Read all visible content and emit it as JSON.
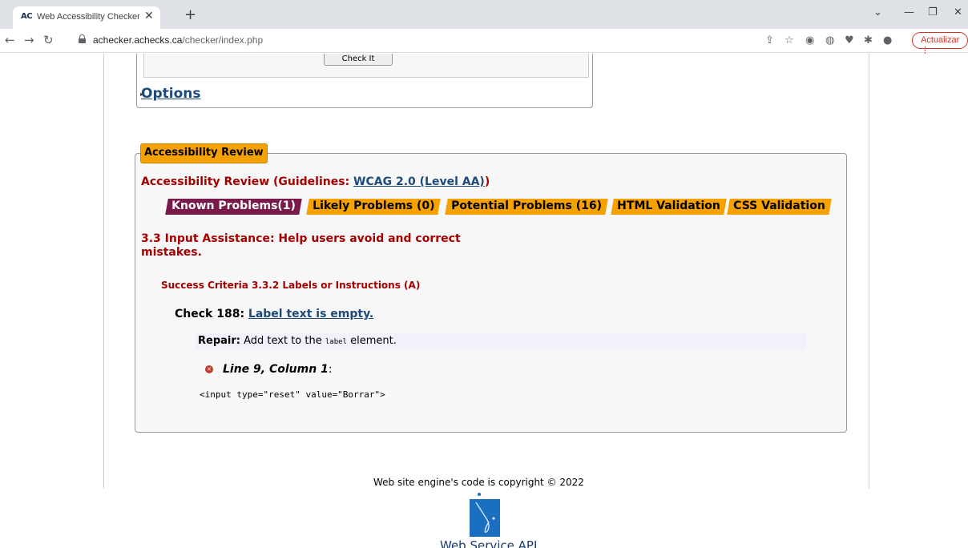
{
  "browser": {
    "tab_favicon": "AC",
    "tab_title": "Web Accessibility Checker for We",
    "tab_close": "✕",
    "new_tab": "+",
    "url_host": "achecker.achecks.ca",
    "url_path": "/checker/index.php",
    "update_button": "Actualizar",
    "icons": [
      "back-icon",
      "forward-icon",
      "reload-icon",
      "lock-icon",
      "share-icon",
      "star-icon",
      "wordpress-icon",
      "extension-icon",
      "heart-icon",
      "puzzle-icon",
      "avatar",
      "menu-icon"
    ]
  },
  "form": {
    "check_button": "Check It",
    "options_link": "Options"
  },
  "review": {
    "legend": "Accessibility Review",
    "heading_prefix": "Accessibility Review (Guidelines: ",
    "heading_link": "WCAG 2.0 (Level AA)",
    "heading_suffix": ")",
    "tabs": [
      {
        "label": "Known Problems(1)",
        "active": true
      },
      {
        "label": "Likely Problems (0)",
        "active": false
      },
      {
        "label": "Potential Problems (16)",
        "active": false
      },
      {
        "label": "HTML Validation",
        "active": false
      },
      {
        "label": "CSS Validation",
        "active": false
      }
    ],
    "problem_heading": "3.3 Input Assistance: Help users avoid and correct mistakes.",
    "criteria": "Success Criteria 3.3.2 Labels or Instructions (A)",
    "check_prefix": "Check 188: ",
    "check_link": "Label text is empty.",
    "repair_label": "Repair:",
    "repair_text_before": " Add text to the ",
    "repair_code": "label",
    "repair_text_after": " element.",
    "location": "Line 9, Column 1",
    "location_colon": ":",
    "code_snippet": "<input type=\"reset\" value=\"Borrar\">"
  },
  "footer": {
    "copyright": "Web site engine's code is copyright © 2022",
    "logo_label": "Web Service API"
  },
  "colors": {
    "accent_orange": "#f5a200",
    "active_tab": "#7a1a4a",
    "heading_red": "#a50000",
    "link_blue": "#1d4a7a"
  }
}
